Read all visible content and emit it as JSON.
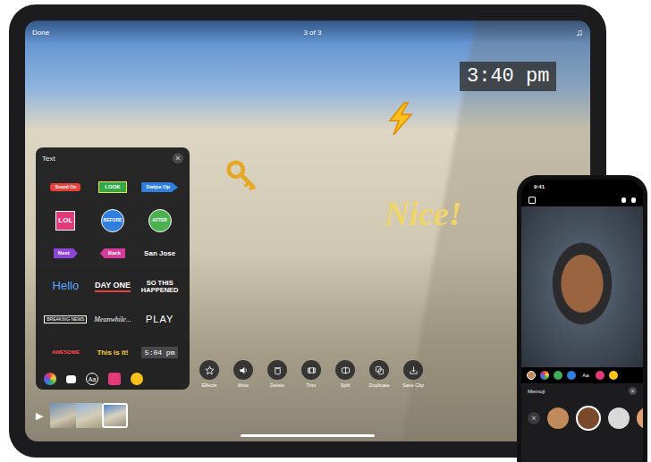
{
  "ipad": {
    "top_bar": {
      "done": "Done",
      "counter": "3 of 3",
      "music": "♫"
    },
    "overlays": [
      {
        "kind": "time",
        "text": "3:40 pm"
      },
      {
        "kind": "caption",
        "text": "Nice!"
      }
    ],
    "text_panel": {
      "title": "Text",
      "close": "×",
      "stickers": [
        {
          "text": "Sound On",
          "kind": "pill",
          "color": "#e8413c"
        },
        {
          "text": "LOOK",
          "kind": "flag",
          "color": "#2faa4a"
        },
        {
          "text": "Swipe Up",
          "kind": "arrow-right",
          "color": "#2f7fe0"
        },
        {
          "text": "LOL",
          "kind": "square",
          "color": "#e5397a"
        },
        {
          "text": "BEFORE",
          "kind": "circle",
          "color": "#2f7fe0"
        },
        {
          "text": "AFTER",
          "kind": "circle",
          "color": "#4caf50"
        },
        {
          "text": "Next",
          "kind": "arrow-right",
          "color": "#8e44d8"
        },
        {
          "text": "Back",
          "kind": "arrow-left",
          "color": "#d63a9a"
        },
        {
          "text": "San Jose",
          "kind": "plain",
          "color": "#ffffff"
        },
        {
          "text": "Hello",
          "kind": "headline",
          "color": "#5aa8ff"
        },
        {
          "text": "DAY ONE",
          "kind": "underline",
          "color": "#ffffff"
        },
        {
          "text": "SO THIS HAPPENED",
          "kind": "stacked",
          "color": "#ffffff"
        },
        {
          "text": "BREAKING NEWS",
          "kind": "boxed",
          "color": "#ffffff"
        },
        {
          "text": "Meanwhile...",
          "kind": "script",
          "color": "#ffffff"
        },
        {
          "text": "PLAY",
          "kind": "outline",
          "color": "#ffffff"
        },
        {
          "text": "AWESOME",
          "kind": "banner",
          "color": "#ff4b4b"
        },
        {
          "text": "This is it!",
          "kind": "bold",
          "color": "#ffd23f"
        },
        {
          "text": "5:04 pm",
          "kind": "timebox",
          "color": "#ffffff"
        }
      ],
      "tabs": [
        {
          "kind": "palette",
          "selected": false
        },
        {
          "kind": "bubble",
          "selected": false
        },
        {
          "kind": "text",
          "label": "Aa",
          "selected": true
        },
        {
          "kind": "sticker",
          "selected": false
        },
        {
          "kind": "emoji",
          "selected": false
        }
      ]
    },
    "toolbar": [
      {
        "kind": "effects",
        "label": "Effects"
      },
      {
        "kind": "mute",
        "label": "Mute"
      },
      {
        "kind": "delete",
        "label": "Delete"
      },
      {
        "kind": "trim",
        "label": "Trim"
      },
      {
        "kind": "split",
        "label": "Split"
      },
      {
        "kind": "duplicate",
        "label": "Duplicate"
      },
      {
        "kind": "save",
        "label": "Save Clip"
      }
    ],
    "filmstrip": {
      "play": "▶",
      "clips": [
        {
          "selected": false
        },
        {
          "selected": false
        },
        {
          "selected": true
        }
      ]
    }
  },
  "iphone": {
    "time": "9:41",
    "tools": [
      {
        "kind": "memoji",
        "selected": true
      },
      {
        "kind": "palette",
        "selected": false
      },
      {
        "kind": "scenes",
        "selected": false
      },
      {
        "kind": "posters",
        "selected": false
      },
      {
        "kind": "text",
        "label": "Aa",
        "selected": false
      },
      {
        "kind": "sticker",
        "selected": false
      },
      {
        "kind": "emoji",
        "selected": false
      }
    ],
    "memoji_panel": {
      "title": "Memoji",
      "close": "×",
      "none": "×",
      "faces": [
        {
          "selected": false,
          "color": "#c08a5b"
        },
        {
          "selected": true,
          "color": "#7a4a2c"
        },
        {
          "selected": false,
          "color": "#d9d9d9"
        },
        {
          "selected": false,
          "color": "#e0a070"
        }
      ]
    }
  }
}
